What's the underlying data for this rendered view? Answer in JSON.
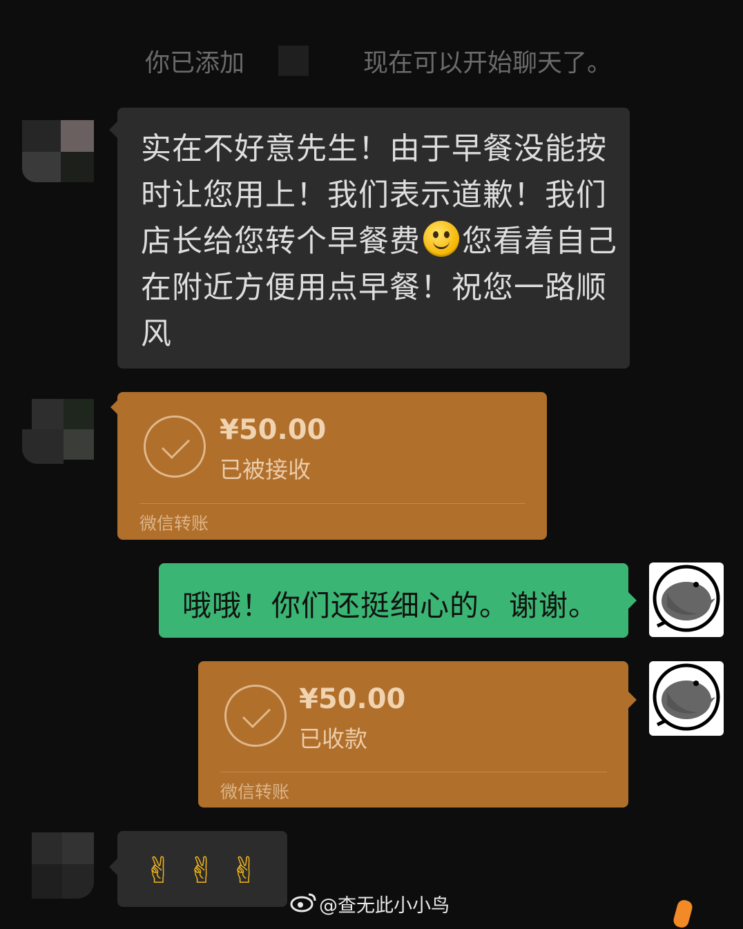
{
  "system_notice": {
    "left": "你已添加",
    "right": "现在可以开始聊天了。"
  },
  "messages": {
    "incoming_text": {
      "before_emoji": "实在不好意先生！由于早餐没能按时让您用上！我们表示道歉！我们店长给您转个早餐费",
      "emoji": "smile-emoji",
      "after_emoji": "您看着自己在附近方便用点早餐！祝您一路顺风"
    },
    "incoming_transfer": {
      "amount": "¥50.00",
      "status": "已被接收",
      "label": "微信转账"
    },
    "outgoing_text": {
      "text": "哦哦！你们还挺细心的。谢谢。"
    },
    "outgoing_transfer": {
      "amount": "¥50.00",
      "status": "已收款",
      "label": "微信转账"
    },
    "incoming_emoji": {
      "emojis": [
        "✌",
        "✌",
        "✌"
      ]
    }
  },
  "watermark": {
    "text": "@查无此小小鸟",
    "icon": "weibo-icon"
  },
  "colors": {
    "background": "#0d0d0d",
    "incoming_bubble": "#2c2c2c",
    "outgoing_bubble": "#3bb573",
    "transfer": "#b06f2b"
  }
}
